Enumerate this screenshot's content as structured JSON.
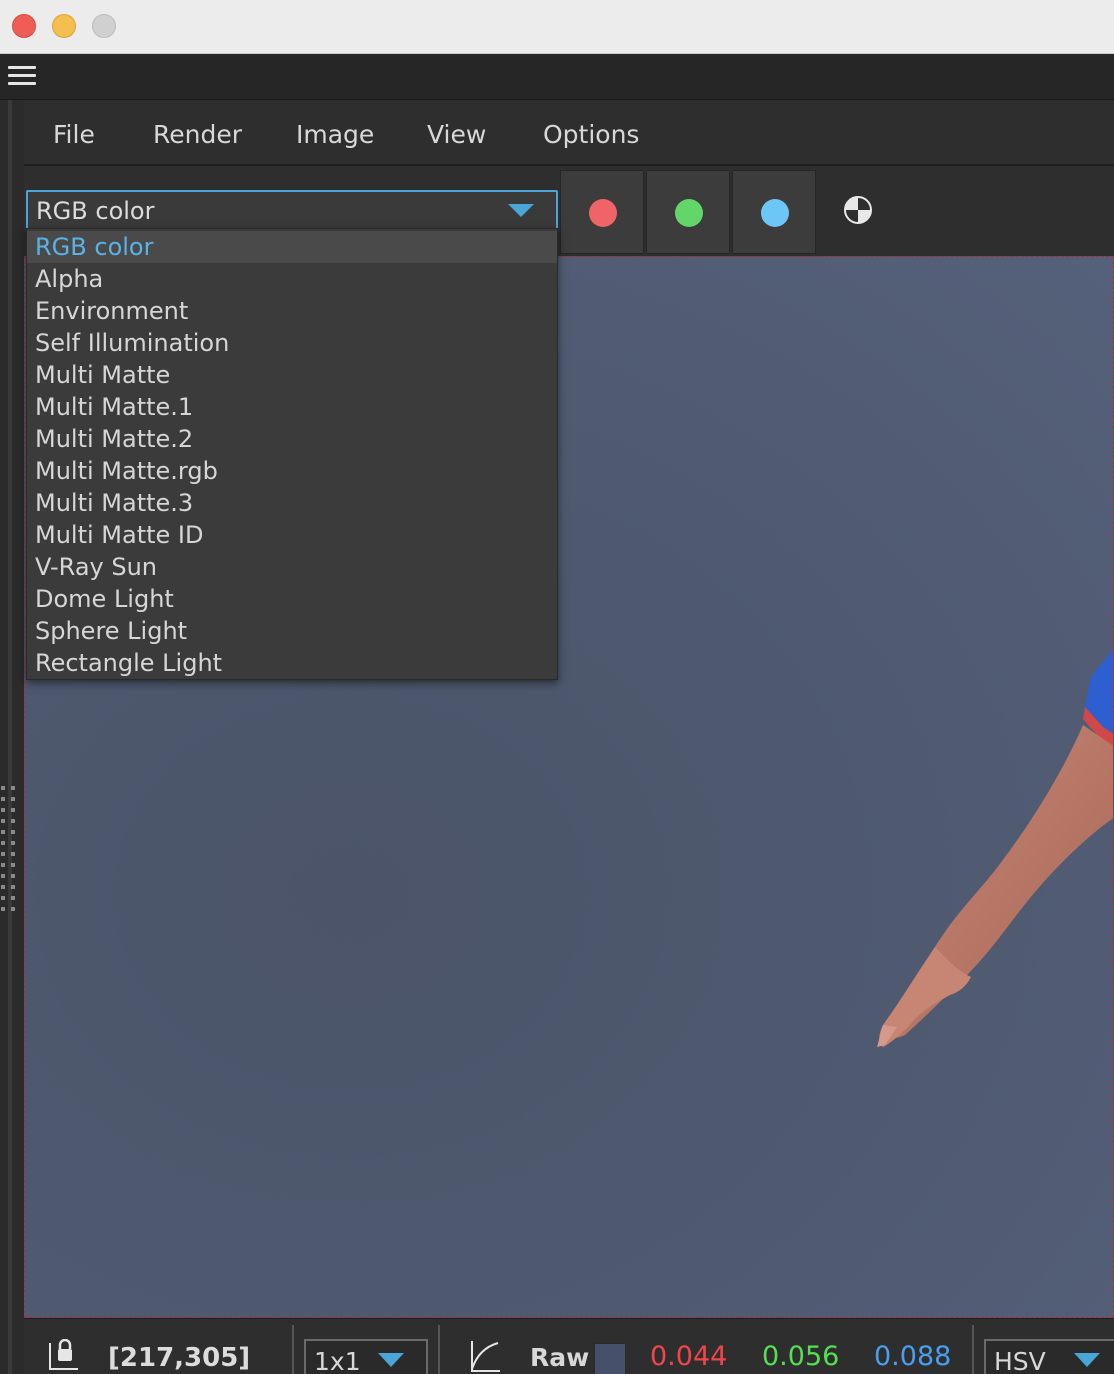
{
  "menubar": {
    "items": [
      "File",
      "Render",
      "Image",
      "View",
      "Options"
    ]
  },
  "channel": {
    "selected": "RGB color",
    "options": [
      "RGB color",
      "Alpha",
      "Environment",
      "Self Illumination",
      "Multi Matte",
      "Multi Matte.1",
      "Multi Matte.2",
      "Multi Matte.rgb",
      "Multi Matte.3",
      "Multi Matte ID",
      "V-Ray Sun",
      "Dome Light",
      "Sphere Light",
      "Rectangle Light"
    ],
    "buttons": [
      {
        "name": "red-channel",
        "color": "#f06468"
      },
      {
        "name": "green-channel",
        "color": "#63d66a"
      },
      {
        "name": "blue-channel",
        "color": "#6cc7f6"
      }
    ]
  },
  "status": {
    "coords": "[217,305]",
    "sample_size": "1x1",
    "mode": "Raw",
    "r": "0.044",
    "g": "0.056",
    "b": "0.088",
    "color_space": "HSV",
    "r_color": "#f0464a",
    "g_color": "#52e052",
    "b_color": "#4a9ef0"
  },
  "icons": [
    "hamburger-menu-icon",
    "lock-icon",
    "curve-icon",
    "dropdown-caret-icon"
  ]
}
